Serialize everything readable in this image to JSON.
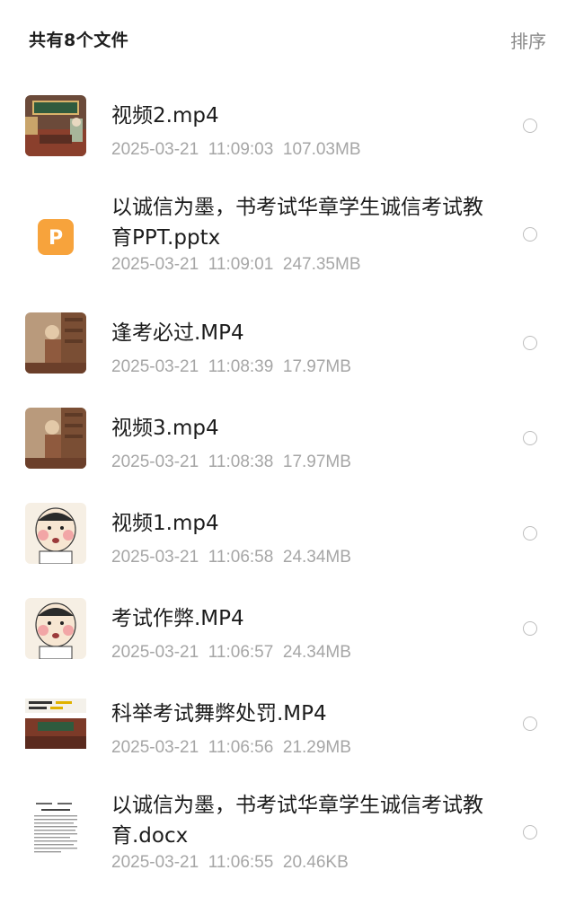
{
  "header": {
    "title": "共有8个文件",
    "sort_label": "排序"
  },
  "files": [
    {
      "name": "视频2.mp4",
      "date": "2025-03-21",
      "time": "11:09:03",
      "size": "107.03MB",
      "thumb": "video-thumbnail"
    },
    {
      "name": "以诚信为墨，书考试华章学生诚信考试教育PPT.pptx",
      "date": "2025-03-21",
      "time": "11:09:01",
      "size": "247.35MB",
      "thumb": "ppt-file-icon"
    },
    {
      "name": "逢考必过.MP4",
      "date": "2025-03-21",
      "time": "11:08:39",
      "size": "17.97MB",
      "thumb": "video-thumbnail"
    },
    {
      "name": "视频3.mp4",
      "date": "2025-03-21",
      "time": "11:08:38",
      "size": "17.97MB",
      "thumb": "video-thumbnail"
    },
    {
      "name": "视频1.mp4",
      "date": "2025-03-21",
      "time": "11:06:58",
      "size": "24.34MB",
      "thumb": "video-thumbnail"
    },
    {
      "name": "考试作弊.MP4",
      "date": "2025-03-21",
      "time": "11:06:57",
      "size": "24.34MB",
      "thumb": "video-thumbnail"
    },
    {
      "name": "科举考试舞弊处罚.MP4",
      "date": "2025-03-21",
      "time": "11:06:56",
      "size": "21.29MB",
      "thumb": "video-thumbnail"
    },
    {
      "name": "以诚信为墨，书考试华章学生诚信考试教育.docx",
      "date": "2025-03-21",
      "time": "11:06:55",
      "size": "20.46KB",
      "thumb": "document-thumbnail"
    }
  ],
  "colors": {
    "ppt_orange": "#F7A33C",
    "meta_gray": "#A6A6A6",
    "radio_border": "#BDBDBD"
  }
}
